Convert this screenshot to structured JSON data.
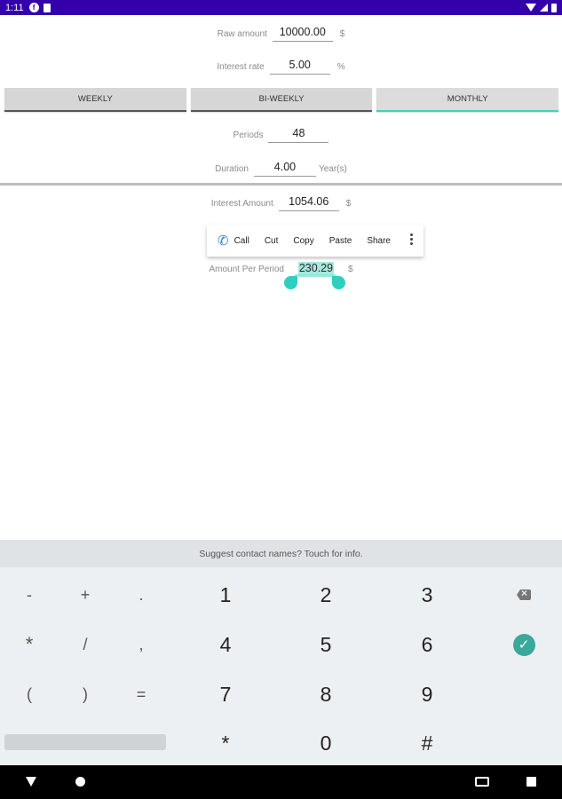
{
  "status_bar": {
    "time": "1:11",
    "notif_icon": "f"
  },
  "form": {
    "raw_amount": {
      "label": "Raw amount",
      "value": "10000.00",
      "unit": "$"
    },
    "interest_rate": {
      "label": "Interest rate",
      "value": "5.00",
      "unit": "%"
    },
    "frequency_buttons": [
      "WEEKLY",
      "BI-WEEKLY",
      "MONTHLY"
    ],
    "active_frequency": "MONTHLY",
    "periods": {
      "label": "Periods",
      "value": "48"
    },
    "duration": {
      "label": "Duration",
      "value": "4.00",
      "unit": "Year(s)"
    },
    "interest_amount": {
      "label": "Interest Amount",
      "value": "1054.06",
      "unit": "$"
    },
    "amount_per_period": {
      "label": "Amount Per Period",
      "value": "230.29",
      "unit": "$"
    }
  },
  "context_menu": {
    "items": [
      "Call",
      "Cut",
      "Copy",
      "Paste",
      "Share"
    ]
  },
  "keyboard": {
    "suggestion": "Suggest contact names? Touch for info.",
    "symbol_keys": [
      "-",
      "+",
      ".",
      "*",
      "/",
      ",",
      "(",
      ")",
      "="
    ],
    "number_keys": [
      "1",
      "2",
      "3",
      "4",
      "5",
      "6",
      "7",
      "8",
      "9",
      "*",
      "0",
      "#"
    ]
  },
  "colors": {
    "status_bar": "#3300aa",
    "accent": "#3fd2c4",
    "selection": "#a6e8df",
    "enter_key": "#3aa89a"
  }
}
